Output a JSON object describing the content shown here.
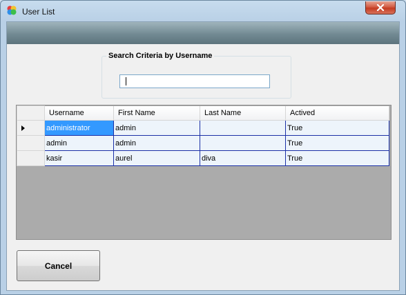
{
  "window": {
    "title": "User List"
  },
  "search": {
    "group_label": "Search Criteria by Username",
    "value": "",
    "placeholder": ""
  },
  "grid": {
    "columns": [
      "Username",
      "First Name",
      "Last Name",
      "Actived"
    ],
    "rows": [
      [
        "administrator",
        "admin",
        "",
        "True"
      ],
      [
        "admin",
        "admin",
        "",
        "True"
      ],
      [
        "kasir",
        "aurel",
        "diva",
        "True"
      ]
    ],
    "selected_row": 0
  },
  "footer": {
    "cancel_label": "Cancel"
  },
  "colors": {
    "selection": "#3399ff",
    "grid_background": "#ababab",
    "close_button": "#c43c22"
  }
}
